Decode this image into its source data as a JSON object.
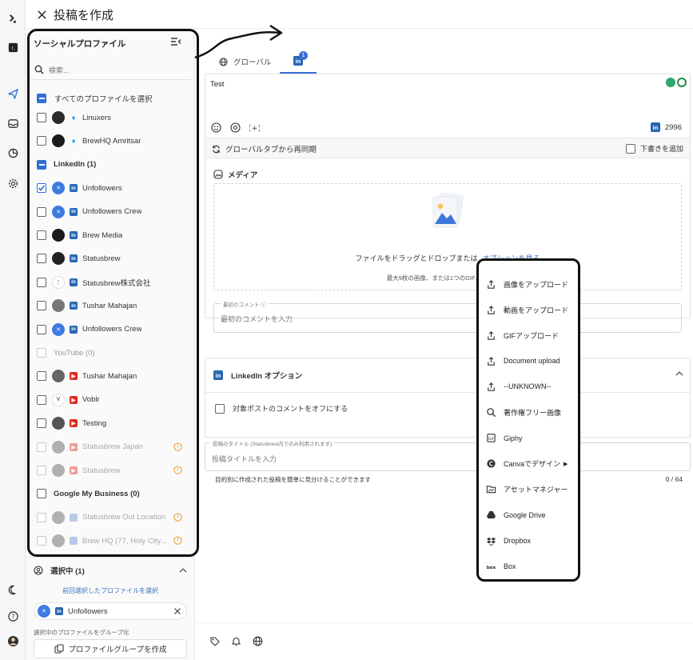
{
  "header": {
    "title": "投稿を作成"
  },
  "rail": {
    "icons": [
      "statusbrew-logo-icon",
      "app-icon",
      "send-icon",
      "inbox-icon",
      "reports-icon",
      "settings-icon",
      "dark-mode-icon",
      "help-icon",
      "user-avatar"
    ]
  },
  "left_panel": {
    "title": "ソーシャルプロファイル",
    "search_placeholder": "検索...",
    "select_all": "すべてのプロファイルを選択",
    "rows": [
      {
        "kind": "profile",
        "label": "Linuxers",
        "network": "twitter",
        "checked": false,
        "dim": false
      },
      {
        "kind": "profile",
        "label": "BrewHQ Amritsar",
        "network": "twitter",
        "checked": false,
        "dim": false
      },
      {
        "kind": "group",
        "label": "LinkedIn (1)"
      },
      {
        "kind": "profile",
        "label": "Unfollowers",
        "network": "linkedin",
        "checked": true,
        "dim": false
      },
      {
        "kind": "profile",
        "label": "Unfollowers Crew",
        "network": "linkedin",
        "checked": false,
        "dim": false
      },
      {
        "kind": "profile",
        "label": "Brew Media",
        "network": "linkedin",
        "checked": false,
        "dim": false
      },
      {
        "kind": "profile",
        "label": "Statusbrew",
        "network": "linkedin",
        "checked": false,
        "dim": false
      },
      {
        "kind": "profile",
        "label": "Statusbrew株式会社",
        "network": "linkedin",
        "checked": false,
        "dim": false
      },
      {
        "kind": "profile",
        "label": "Tushar Mahajan",
        "network": "linkedin",
        "checked": false,
        "dim": false
      },
      {
        "kind": "profile",
        "label": "Unfollowers Crew",
        "network": "linkedin",
        "checked": false,
        "dim": false
      },
      {
        "kind": "group",
        "label": "YouTube (0)"
      },
      {
        "kind": "profile",
        "label": "Tushar Mahajan",
        "network": "youtube",
        "checked": false,
        "dim": false
      },
      {
        "kind": "profile",
        "label": "Voblr",
        "network": "youtube",
        "checked": false,
        "dim": false
      },
      {
        "kind": "profile",
        "label": "Testing",
        "network": "youtube",
        "checked": false,
        "dim": false
      },
      {
        "kind": "profile",
        "label": "Statusbrew Japan",
        "network": "youtube",
        "checked": false,
        "dim": true
      },
      {
        "kind": "profile",
        "label": "Statusbrew",
        "network": "youtube",
        "checked": false,
        "dim": true
      },
      {
        "kind": "group",
        "label": "Google My Business (0)"
      },
      {
        "kind": "profile",
        "label": "Statusbrew Out Location",
        "network": "gmb",
        "checked": false,
        "dim": true
      },
      {
        "kind": "profile",
        "label": "Brew HQ (77, Holy City...",
        "network": "gmb",
        "checked": false,
        "dim": true
      }
    ],
    "selected_title": "選択中 (1)",
    "previous_link": "前回選択したプロファイルを選択",
    "selected_chip": "Unfollowers",
    "group_note": "選択中のプロファイルをグループ化",
    "group_button": "プロファイルグループを作成"
  },
  "tabs": {
    "global": "グローバル",
    "linkedin_badge": "1"
  },
  "editor": {
    "text": "Test",
    "char_count": "2996",
    "resync_label": "グローバルタブから再同期",
    "draft_label": "下書きを追加",
    "media_label": "メディア",
    "dropzone_text": "ファイルをドラッグとドロップまたは",
    "dropzone_link": "オプションを見る",
    "dropzone_sub": "最大9枚の画像、または1つのGIF、または1本",
    "first_comment_label": "最初のコメント",
    "first_comment_placeholder": "最初のコメントを入力"
  },
  "linkedin_options": {
    "title": "LinkedIn オプション",
    "disable_comments": "対象ポストのコメントをオフにする"
  },
  "post_title": {
    "label": "投稿のタイトル (Statusbrew内でのみ利用されます)",
    "placeholder": "投稿タイトルを入力",
    "help": "目的別に作成された投稿を簡単に見分けることができます",
    "count": "0 / 64"
  },
  "upload_menu": [
    {
      "label": "画像をアップロード",
      "icon": "upload-icon"
    },
    {
      "label": "動画をアップロード",
      "icon": "upload-icon"
    },
    {
      "label": "GIFアップロード",
      "icon": "upload-icon"
    },
    {
      "label": "Document upload",
      "icon": "upload-icon"
    },
    {
      "label": "--UNKNOWN--",
      "icon": "upload-icon"
    },
    {
      "label": "著作権フリー画像",
      "icon": "search-icon"
    },
    {
      "label": "Giphy",
      "icon": "giphy-icon"
    },
    {
      "label": "Canvaでデザイン",
      "icon": "canva-icon",
      "submenu": true
    },
    {
      "label": "アセットマネジャー",
      "icon": "folder-icon"
    },
    {
      "label": "Google Drive",
      "icon": "google-drive-icon"
    },
    {
      "label": "Dropbox",
      "icon": "dropbox-icon"
    },
    {
      "label": "Box",
      "icon": "box-icon"
    }
  ],
  "colors": {
    "accent": "#2f6fd6",
    "linkedin": "#2867b2",
    "twitter": "#1da1f2",
    "youtube": "#e02b20",
    "warning": "#e8a13a"
  }
}
